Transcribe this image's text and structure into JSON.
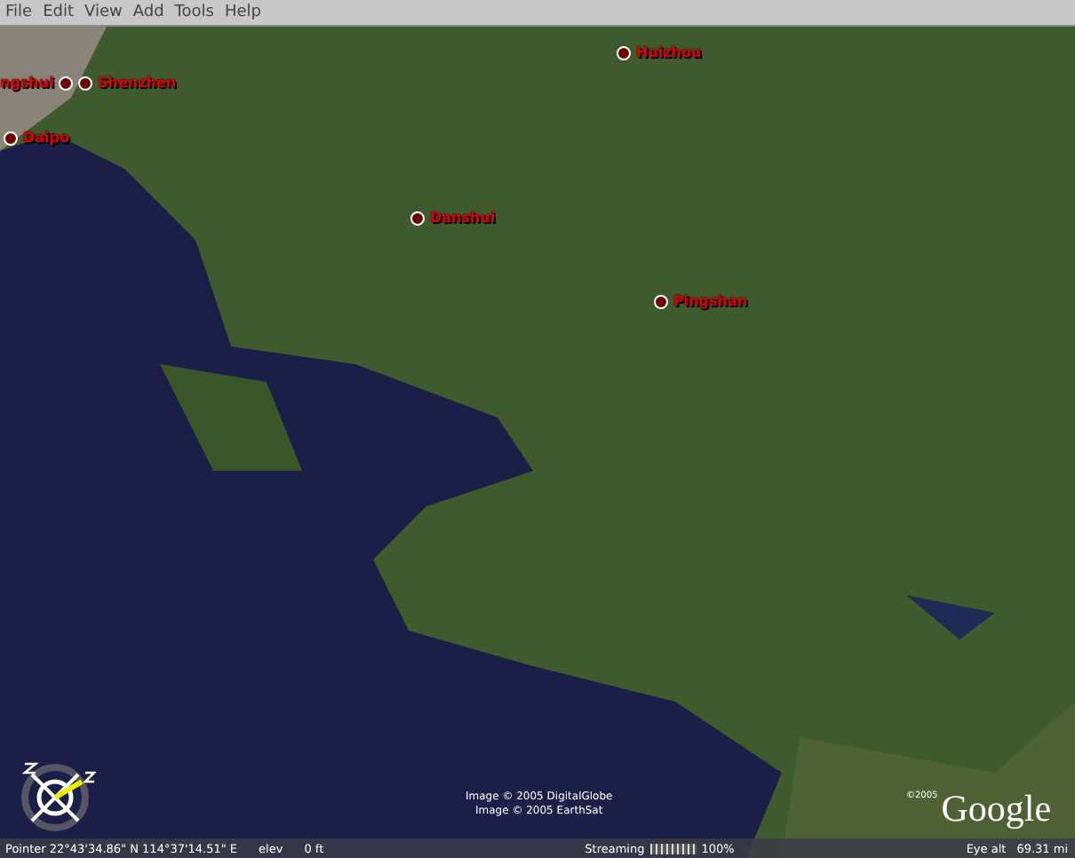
{
  "menu_bar": [
    "File",
    "Edit",
    "View",
    "Add",
    "Tools",
    "Help"
  ],
  "placemarks": [
    {
      "label": "ngshui"
    },
    {
      "label": "Shenzhen"
    },
    {
      "label": "Daipo"
    },
    {
      "label": "Huizhou"
    },
    {
      "label": "Danshui"
    },
    {
      "label": "Pingshan"
    }
  ],
  "attribution": [
    "Image © 2005 DigitalGlobe",
    "Image © 2005 EarthSat"
  ],
  "logo": {
    "copyright": "©2005",
    "name": "Google"
  },
  "status_bar": {
    "pointer": "Pointer  22°43'34.86\" N  114°37'14.51\" E",
    "elev_label": "elev",
    "elev_value": "0 ft",
    "streaming": {
      "label": "Streaming",
      "level": 1,
      "reading": "100%"
    },
    "eye_alt_label": "Eye alt",
    "eye_alt_value": "69.31 mi"
  }
}
